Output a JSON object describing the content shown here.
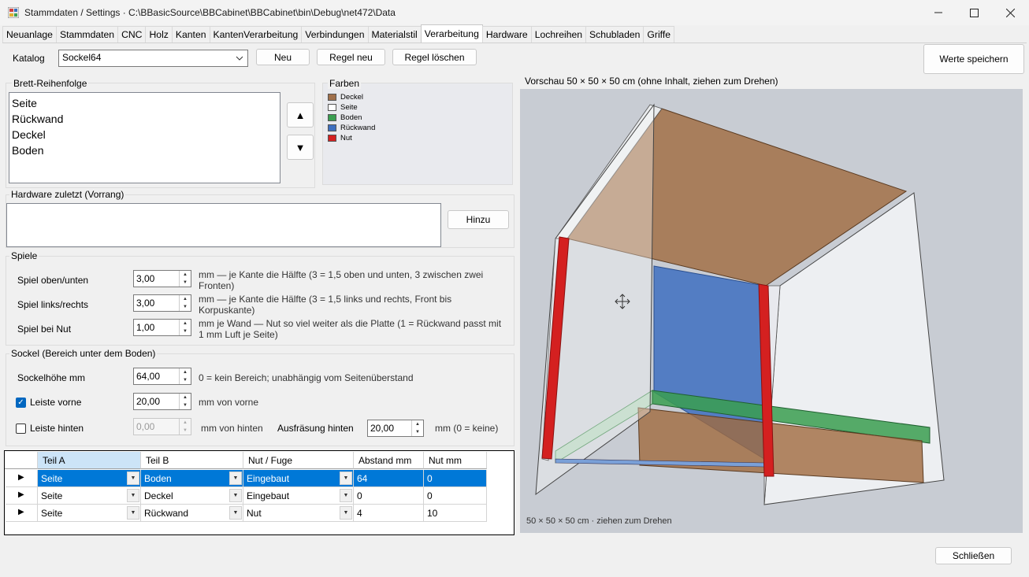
{
  "window": {
    "title": "Stammdaten / Settings  ·  C:\\BBasicSource\\BBCabinet\\BBCabinet\\bin\\Debug\\net472\\Data"
  },
  "tabs": [
    "Neuanlage",
    "Stammdaten",
    "CNC",
    "Holz",
    "Kanten",
    "KantenVerarbeitung",
    "Verbindungen",
    "Materialstil",
    "Verarbeitung",
    "Hardware",
    "Lochreihen",
    "Schubladen",
    "Griffe"
  ],
  "active_tab": "Verarbeitung",
  "katalog": {
    "label": "Katalog",
    "value": "Sockel64",
    "neu": "Neu",
    "regel_neu": "Regel neu",
    "regel_loeschen": "Regel löschen"
  },
  "save_button": "Werte speichern",
  "brett": {
    "title": "Brett-Reihenfolge",
    "items": [
      "Seite",
      "Rückwand",
      "Deckel",
      "Boden"
    ],
    "up": "▲",
    "down": "▼"
  },
  "farben": {
    "title": "Farben",
    "items": [
      {
        "label": "Deckel",
        "color": "#a0704b"
      },
      {
        "label": "Seite",
        "color": "#ffffff"
      },
      {
        "label": "Boden",
        "color": "#3a9e50"
      },
      {
        "label": "Rückwand",
        "color": "#3e6fbf"
      },
      {
        "label": "Nut",
        "color": "#d42020"
      }
    ]
  },
  "hardware": {
    "title": "Hardware zuletzt (Vorrang)",
    "hinzu": "Hinzu"
  },
  "spiele": {
    "title": "Spiele",
    "rows": [
      {
        "label": "Spiel oben/unten",
        "value": "3,00",
        "note": "mm — je Kante die Hälfte (3 = 1,5 oben und unten, 3 zwischen zwei Fronten)"
      },
      {
        "label": "Spiel links/rechts",
        "value": "3,00",
        "note": "mm — je Kante die Hälfte (3 = 1,5 links und rechts, Front bis Korpuskante)"
      },
      {
        "label": "Spiel bei Nut",
        "value": "1,00",
        "note": "mm je Wand — Nut so viel weiter als die Platte (1 = Rückwand passt mit 1 mm Luft je Seite)"
      }
    ]
  },
  "sockel": {
    "title": "Sockel (Bereich unter dem Boden)",
    "hoehe_label": "Sockelhöhe mm",
    "hoehe_value": "64,00",
    "hoehe_note": "0 = kein Bereich; unabhängig vom Seitenüberstand",
    "vorne_label": "Leiste vorne",
    "vorne_checked": true,
    "vorne_value": "20,00",
    "vorne_note": "mm von vorne",
    "hinten_label": "Leiste hinten",
    "hinten_checked": false,
    "hinten_value": "0,00",
    "hinten_note": "mm von hinten",
    "ausfraesung_label": "Ausfräsung hinten",
    "ausfraesung_value": "20,00",
    "ausfraesung_note": "mm (0 = keine)"
  },
  "grid": {
    "columns": [
      "Teil A",
      "Teil B",
      "Nut / Fuge",
      "Abstand mm",
      "Nut mm"
    ],
    "rows": [
      [
        "Seite",
        "Boden",
        "Eingebaut",
        "64",
        "0"
      ],
      [
        "Seite",
        "Deckel",
        "Eingebaut",
        "0",
        "0"
      ],
      [
        "Seite",
        "Rückwand",
        "Nut",
        "4",
        "10"
      ]
    ]
  },
  "preview": {
    "title": "Vorschau 50 × 50 × 50 cm (ohne Inhalt, ziehen zum Drehen)",
    "footer": "50 × 50 × 50 cm  ·  ziehen zum Drehen"
  },
  "close_button": "Schließen"
}
